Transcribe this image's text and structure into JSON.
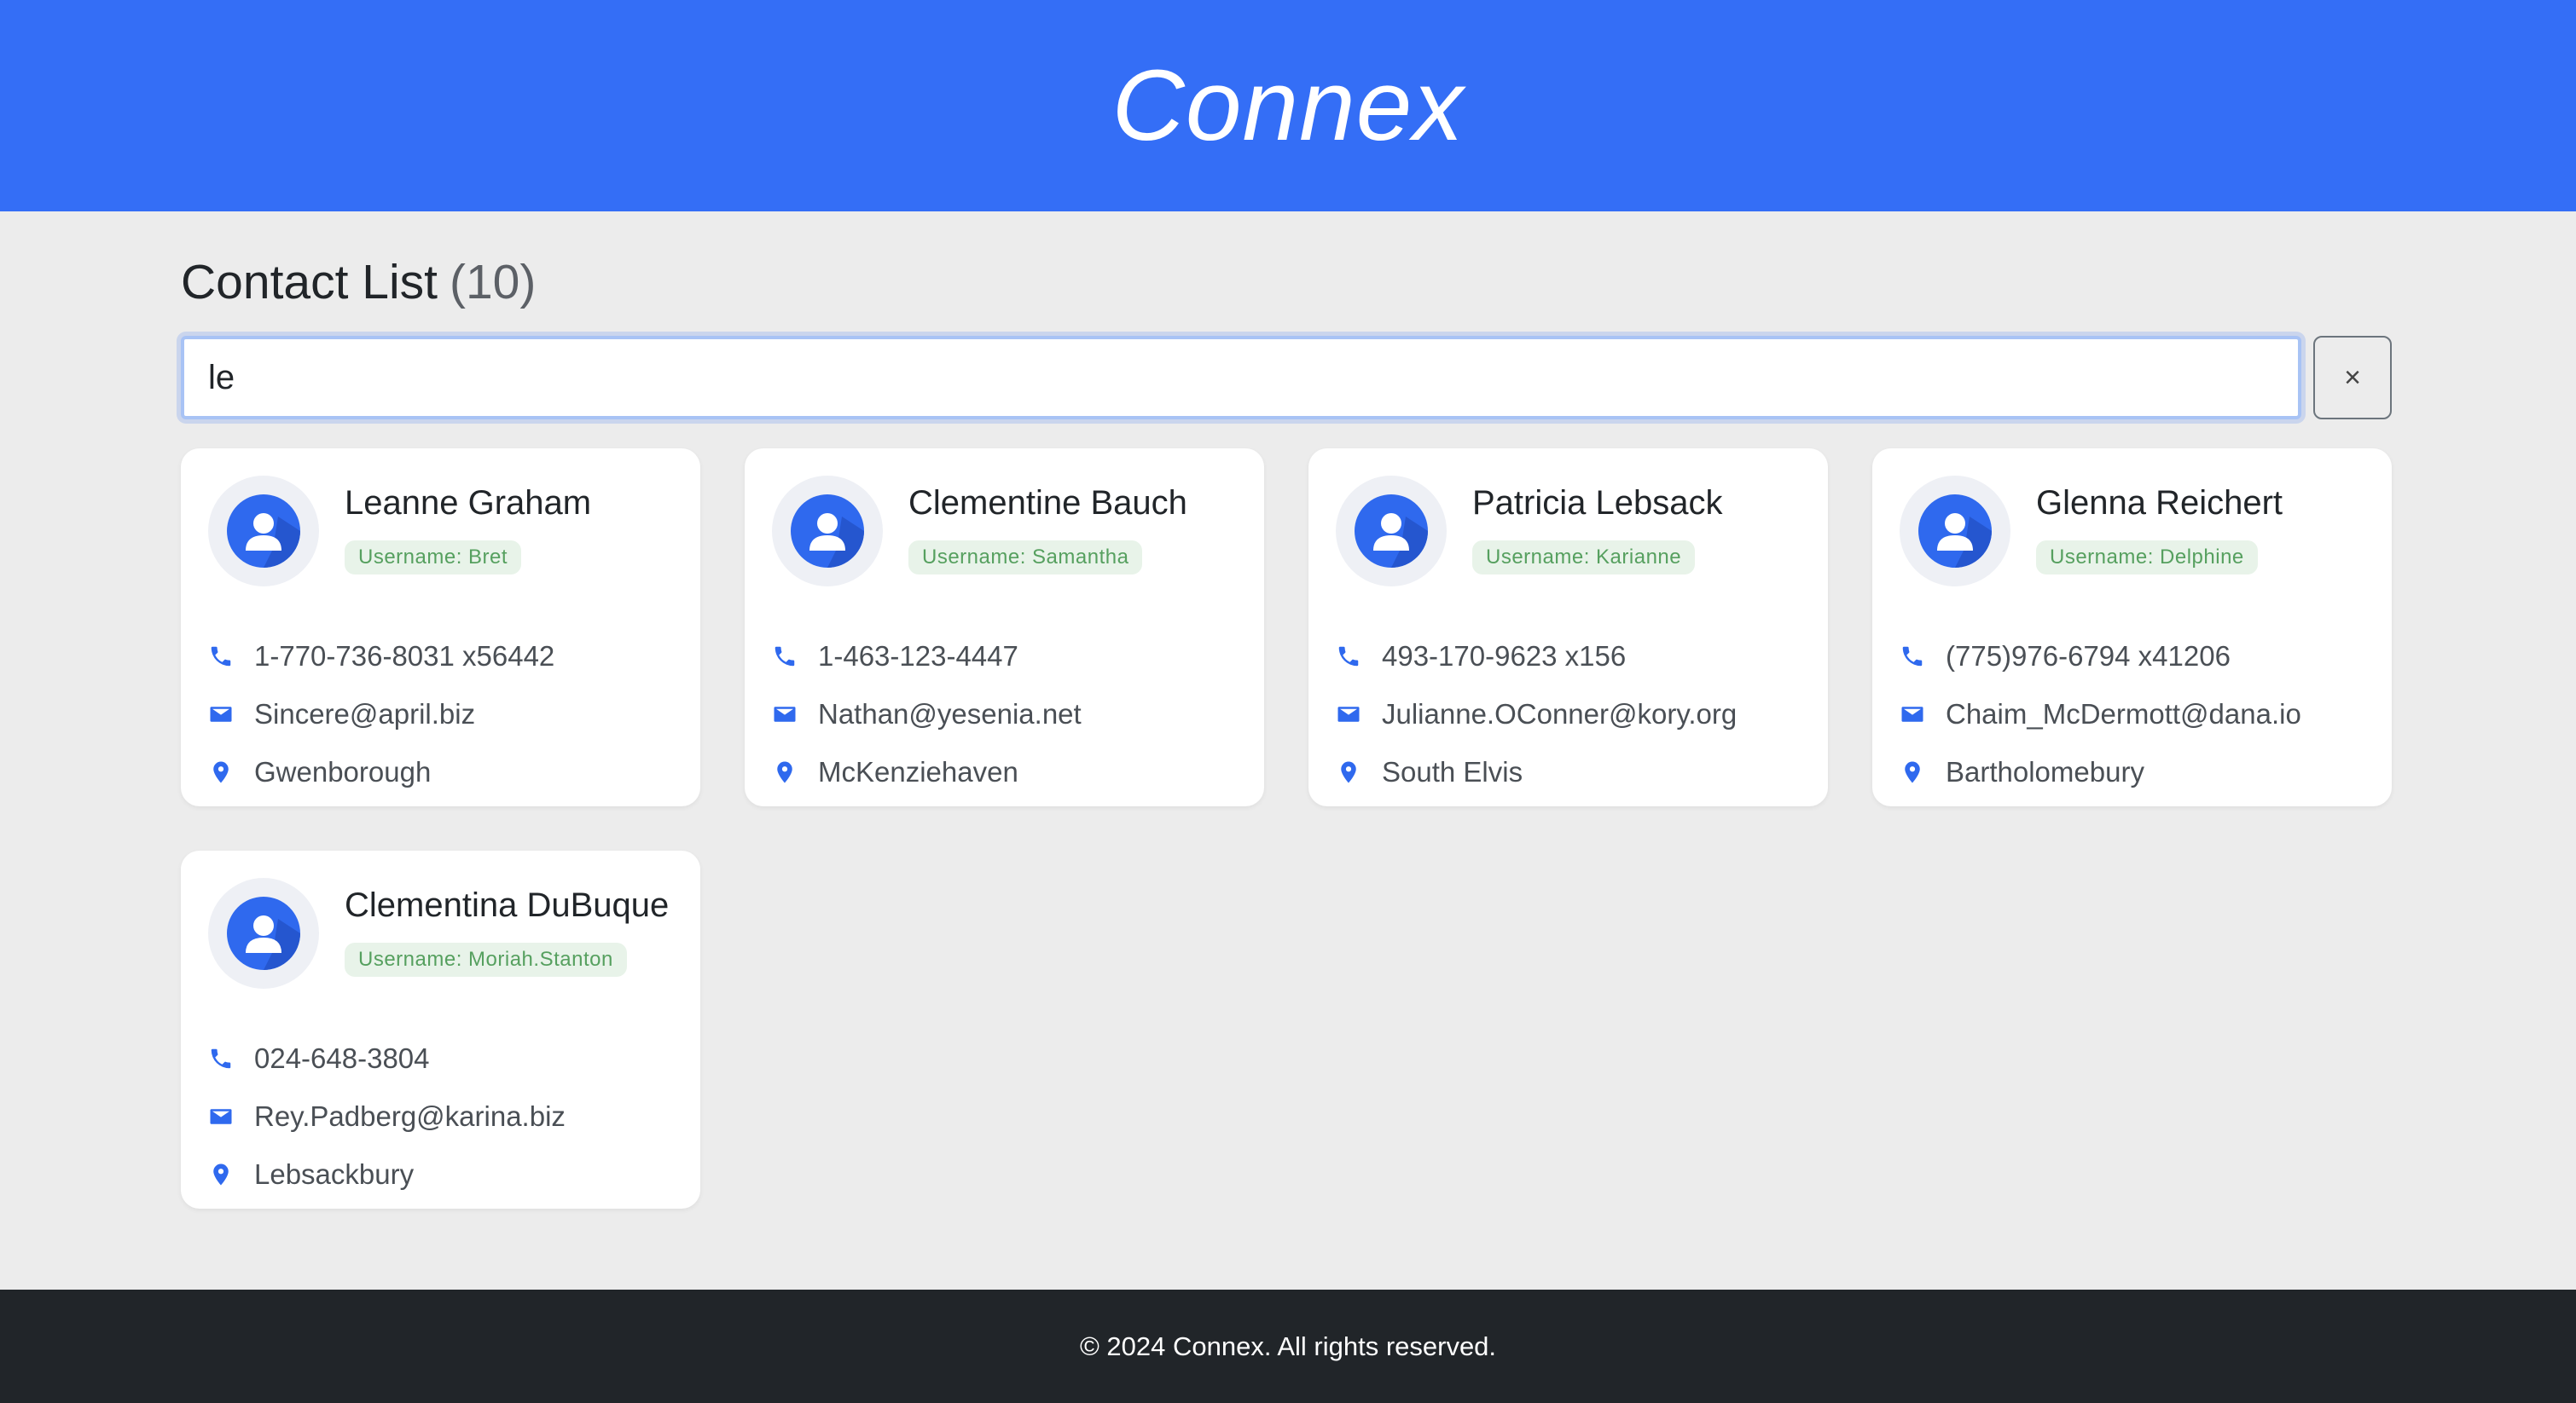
{
  "header": {
    "brand": "Connex"
  },
  "main": {
    "title": "Contact List",
    "count": "(10)",
    "search": {
      "value": "le",
      "placeholder": ""
    },
    "clear_label": "×"
  },
  "contacts": [
    {
      "name": "Leanne Graham",
      "username": "Username: Bret",
      "phone": "1-770-736-8031 x56442",
      "email": "Sincere@april.biz",
      "city": "Gwenborough"
    },
    {
      "name": "Clementine Bauch",
      "username": "Username: Samantha",
      "phone": "1-463-123-4447",
      "email": "Nathan@yesenia.net",
      "city": "McKenziehaven"
    },
    {
      "name": "Patricia Lebsack",
      "username": "Username: Karianne",
      "phone": "493-170-9623 x156",
      "email": "Julianne.OConner@kory.org",
      "city": "South Elvis"
    },
    {
      "name": "Glenna Reichert",
      "username": "Username: Delphine",
      "phone": "(775)976-6794 x41206",
      "email": "Chaim_McDermott@dana.io",
      "city": "Bartholomebury"
    },
    {
      "name": "Clementina DuBuque",
      "username": "Username: Moriah.Stanton",
      "phone": "024-648-3804",
      "email": "Rey.Padberg@karina.biz",
      "city": "Lebsackbury"
    }
  ],
  "icons": {
    "avatar": "user-avatar-icon",
    "phone": "phone-icon",
    "email": "envelope-icon",
    "location": "map-pin-icon",
    "clear": "close-icon"
  },
  "colors": {
    "brand": "#346ef6",
    "background": "#ececec",
    "badge_text": "#56a05f",
    "badge_bg": "#e8f3e9",
    "footer": "#212529"
  },
  "footer": {
    "text": "© 2024 Connex. All rights reserved."
  }
}
